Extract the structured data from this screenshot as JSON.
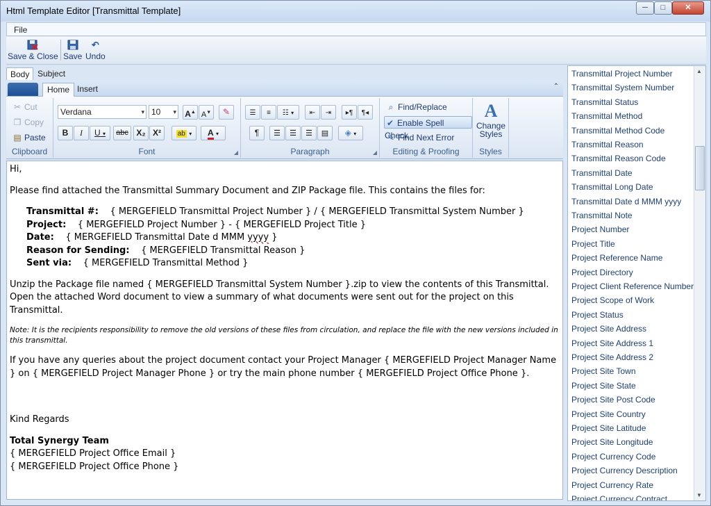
{
  "window": {
    "title": "Html Template Editor [Transmittal Template]",
    "controls": {
      "minimize": "─",
      "maximize": "□",
      "close": "✕"
    }
  },
  "menu": {
    "file": "File"
  },
  "toolbar": {
    "save_close": "Save & Close",
    "save": "Save",
    "undo": "Undo"
  },
  "doc_tabs": {
    "body": "Body",
    "subject": "Subject"
  },
  "ribbon": {
    "tabs": {
      "home": "Home",
      "insert": "Insert"
    },
    "clipboard": {
      "cut": "Cut",
      "copy": "Copy",
      "paste": "Paste",
      "label": "Clipboard"
    },
    "font": {
      "family": "Verdana",
      "size": "10",
      "label": "Font",
      "bold": "B",
      "italic": "I",
      "underline": "U",
      "strike": "abc",
      "subscript": "X₂",
      "superscript": "X²",
      "font_color": "A"
    },
    "paragraph": {
      "label": "Paragraph",
      "pilcrow": "¶"
    },
    "editing": {
      "find_replace": "Find/Replace",
      "spell_check": "Enable Spell Check",
      "find_next_error": "Find Next Error",
      "label": "Editing & Proofing"
    },
    "styles": {
      "change_styles": "Change Styles",
      "label": "Styles"
    }
  },
  "editor": {
    "greeting": "Hi,",
    "intro": "Please find attached the Transmittal Summary Document and ZIP Package file. This contains the files for:",
    "details": [
      {
        "label": "Transmittal #:",
        "value": "{ MERGEFIELD Transmittal Project Number } / { MERGEFIELD Transmittal System Number }"
      },
      {
        "label": "Project:",
        "value": "{ MERGEFIELD Project Number } - { MERGEFIELD Project Title }"
      },
      {
        "label": "Date:",
        "value_before": "{ MERGEFIELD Transmittal Date d MMM ",
        "value_spell": "yyyy",
        "value_after": " }"
      },
      {
        "label": "Reason for Sending:",
        "value": "{ MERGEFIELD Transmittal Reason }"
      },
      {
        "label": "Sent via:",
        "value": "{ MERGEFIELD Transmittal Method }"
      }
    ],
    "unzip": "Unzip the Package file named { MERGEFIELD Transmittal System Number }.zip to view the contents of this Transmittal.",
    "open_word": "Open the attached Word document to view a summary of what documents were sent out for the project on this Transmittal.",
    "note": "Note: It is the recipients responsibility to remove the old versions of these files from circulation, and replace the file with the new versions included in this transmittal.",
    "queries": "If you have any queries about the project document contact your Project Manager { MERGEFIELD Project Manager Name } on { MERGEFIELD Project Manager Phone } or try the main phone number { MERGEFIELD Project Office Phone }.",
    "regards": "Kind Regards",
    "team": "Total Synergy Team",
    "email_field": "{ MERGEFIELD Project Office Email }",
    "phone_field": "{ MERGEFIELD Project Office Phone }"
  },
  "fields": [
    "Transmittal Project Number",
    "Transmittal System Number",
    "Transmittal Status",
    "Transmittal Method",
    "Transmittal Method Code",
    "Transmittal Reason",
    "Transmittal Reason Code",
    "Transmittal Date",
    "Transmittal Long Date",
    "Transmittal Date d MMM yyyy",
    "Transmittal Note",
    "Project Number",
    "Project Title",
    "Project Reference Name",
    "Project Directory",
    "Project Client Reference Number",
    "Project Scope of Work",
    "Project Status",
    "Project Site Address",
    "Project Site Address 1",
    "Project Site Address 2",
    "Project Site Town",
    "Project Site State",
    "Project Site Post Code",
    "Project Site Country",
    "Project Site Latitude",
    "Project Site Longitude",
    "Project Currency Code",
    "Project Currency Description",
    "Project Currency Rate",
    "Project Currency Contract"
  ]
}
